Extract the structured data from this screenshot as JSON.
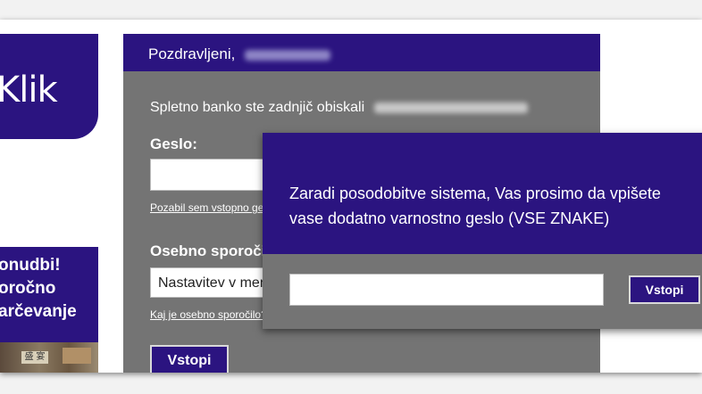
{
  "logo": {
    "text": "Klik"
  },
  "promo": {
    "lines": [
      "onudbi!",
      "oročno",
      "arčevanje"
    ],
    "image_sign": "盛 宴"
  },
  "login": {
    "greeting": "Pozdravljeni,",
    "last_visit": "Spletno banko ste zadnjič obiskali",
    "password_label": "Geslo:",
    "forgot_link": "Pozabil sem vstopno geslo",
    "personal_label": "Osebno sporočilo",
    "personal_select": "Nastavitev v meniju",
    "personal_link": "Kaj je osebno sporočilo?",
    "submit": "Vstopi"
  },
  "modal": {
    "message_line1": "Zaradi posodobitve sistema, Vas prosimo da vpišete",
    "message_line2": "vase dodatno varnostno geslo (VSE ZNAKE)",
    "input_value": "",
    "submit": "Vstopi"
  },
  "colors": {
    "brand": "#2b1480",
    "panel": "#747474"
  }
}
